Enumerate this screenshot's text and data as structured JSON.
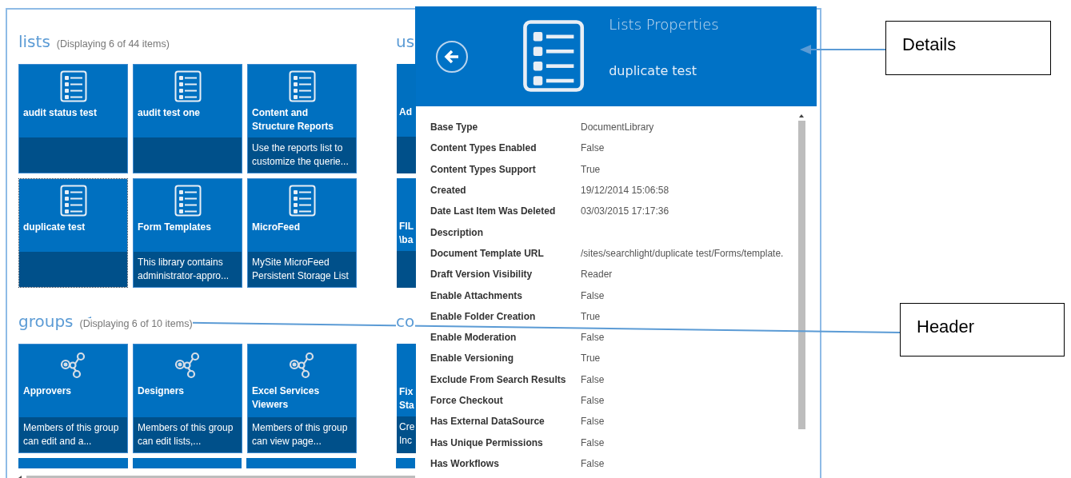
{
  "sections": [
    {
      "kind": "list",
      "title": "lists",
      "count": "(Displaying 6 of 44 items)",
      "tiles": [
        {
          "title": "audit status test",
          "selected": false
        },
        {
          "title": "audit test one",
          "selected": false
        },
        {
          "title": "Content and Structure Reports",
          "description": "Use the reports list to customize the querie...",
          "selected": false
        },
        {
          "title": "duplicate test",
          "selected": true
        },
        {
          "title": "Form Templates",
          "description": "This library contains administrator-appro...",
          "selected": false
        },
        {
          "title": "MicroFeed",
          "description": "MySite MicroFeed Persistent Storage List",
          "selected": false
        }
      ],
      "peek": {
        "title": "us",
        "tiles": [
          {
            "title_lines": [
              "Ad"
            ]
          },
          {
            "title_lines": [
              "FIL",
              "\\ba"
            ]
          }
        ]
      }
    },
    {
      "kind": "group",
      "title": "groups",
      "count": "(Displaying 6 of 10 items)",
      "tiles": [
        {
          "title": "Approvers",
          "description": "Members of this group can edit and a...",
          "selected": false
        },
        {
          "title": "Designers",
          "description": "Members of this group can edit lists,...",
          "selected": false
        },
        {
          "title": "Excel Services Viewers",
          "description": "Members of this group can view page...",
          "selected": false
        }
      ],
      "peek": {
        "title": "co",
        "tiles": [
          {
            "title_lines": [
              "Fix",
              "Sta"
            ],
            "description_lines": [
              "Cre",
              "Inc"
            ]
          }
        ]
      }
    }
  ],
  "details": {
    "title": "Lists Properties",
    "subtitle": "duplicate test",
    "properties": [
      {
        "name": "Base Type",
        "value": "DocumentLibrary"
      },
      {
        "name": "Content Types Enabled",
        "value": "False"
      },
      {
        "name": "Content Types Support",
        "value": "True"
      },
      {
        "name": "Created",
        "value": "19/12/2014 15:06:58"
      },
      {
        "name": "Date Last Item Was Deleted",
        "value": "03/03/2015 17:17:36"
      },
      {
        "name": "Description"
      },
      {
        "name": "Document Template URL",
        "value": "/sites/searchlight/duplicate test/Forms/template."
      },
      {
        "name": "Draft Version Visibility",
        "value": "Reader"
      },
      {
        "name": "Enable Attachments",
        "value": "False"
      },
      {
        "name": "Enable Folder Creation",
        "value": "True"
      },
      {
        "name": "Enable Moderation",
        "value": "False"
      },
      {
        "name": "Enable Versioning",
        "value": "True"
      },
      {
        "name": "Exclude From Search Results",
        "value": "False"
      },
      {
        "name": "Force Checkout",
        "value": "False"
      },
      {
        "name": "Has External DataSource",
        "value": "False"
      },
      {
        "name": "Has Unique Permissions",
        "value": "False"
      },
      {
        "name": "Has Workflows",
        "value": "False"
      }
    ]
  },
  "annotations": [
    {
      "label": "Details"
    },
    {
      "label": "Header"
    }
  ]
}
